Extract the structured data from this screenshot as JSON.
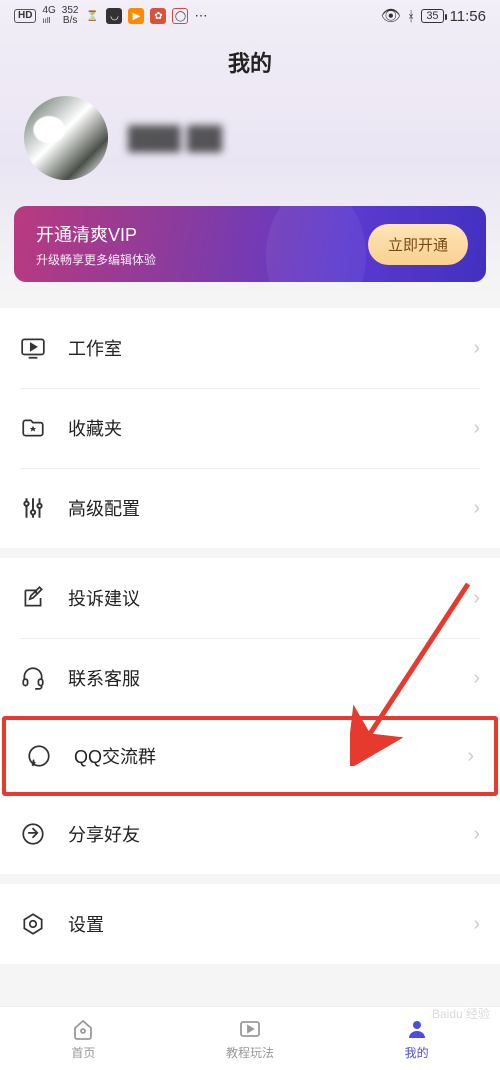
{
  "status": {
    "hd": "HD",
    "net": "4G",
    "speed": "352",
    "speed_unit": "B/s",
    "battery": "35",
    "time": "11:56"
  },
  "header": {
    "title": "我的",
    "username": "▓▓▓ ▓▓"
  },
  "vip": {
    "title": "开通清爽VIP",
    "subtitle": "升级畅享更多编辑体验",
    "button": "立即开通"
  },
  "group1": [
    {
      "key": "studio",
      "label": "工作室"
    },
    {
      "key": "favorites",
      "label": "收藏夹"
    },
    {
      "key": "advanced",
      "label": "高级配置"
    }
  ],
  "group2": [
    {
      "key": "feedback",
      "label": "投诉建议"
    },
    {
      "key": "support",
      "label": "联系客服"
    },
    {
      "key": "qq-group",
      "label": "QQ交流群",
      "highlight": true
    },
    {
      "key": "share",
      "label": "分享好友"
    }
  ],
  "group3": [
    {
      "key": "settings",
      "label": "设置"
    }
  ],
  "bottomNav": [
    {
      "key": "home",
      "label": "首页"
    },
    {
      "key": "tutorial",
      "label": "教程玩法"
    },
    {
      "key": "mine",
      "label": "我的",
      "active": true
    }
  ],
  "annotation": {
    "arrow_color": "#e73a2e"
  }
}
